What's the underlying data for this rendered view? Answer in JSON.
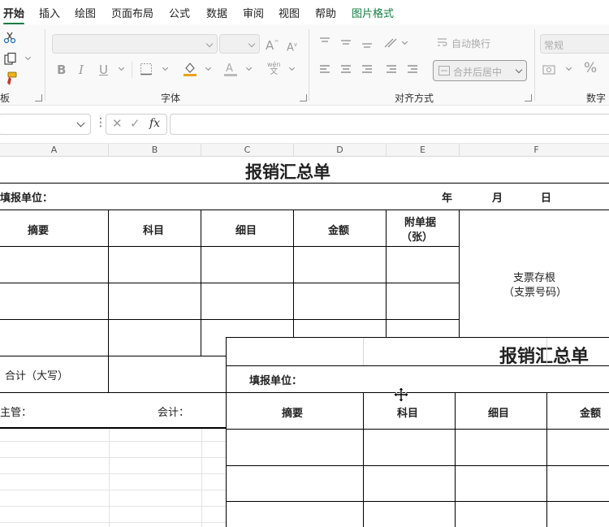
{
  "ribbon": {
    "tabs": [
      "开始",
      "插入",
      "绘图",
      "页面布局",
      "公式",
      "数据",
      "审阅",
      "视图",
      "帮助",
      "图片格式"
    ],
    "groups": {
      "clipboard_label": "板",
      "font_label": "字体",
      "alignment_label": "对齐方式",
      "number_label": "数字"
    },
    "wrap_text": "自动换行",
    "merge_center": "合并后居中",
    "number_format": "常规",
    "font_buttons": {
      "bold": "B",
      "italic": "I",
      "underline": "U"
    },
    "grow_font": "A",
    "percent": "%",
    "wen": "wén",
    "wen_char": "文"
  },
  "formula_bar": {
    "dots": "⋮",
    "fx": "fx",
    "cancel": "✕",
    "confirm": "✓"
  },
  "columns": [
    "A",
    "B",
    "C",
    "D",
    "E",
    "F"
  ],
  "accent_color": "#107c41",
  "form": {
    "title": "报销汇总单",
    "unit_label": "填报单位：",
    "year": "年",
    "month": "月",
    "day": "日",
    "headers": {
      "summary": "摘要",
      "subject": "科目",
      "detail": "细目",
      "amount": "金额",
      "attachments_line1": "附单据",
      "attachments_line2": "（张）"
    },
    "stub_line1": "支票存根",
    "stub_line2": "（支票号码）",
    "total_label": "合计（大写）",
    "supervisor_label": "主管：",
    "accountant_label": "会计："
  },
  "picture_copy": {
    "title": "报销汇总单",
    "unit_label": "填报单位：",
    "headers": {
      "summary": "摘要",
      "subject": "科目",
      "detail": "细目",
      "amount": "金额"
    }
  }
}
